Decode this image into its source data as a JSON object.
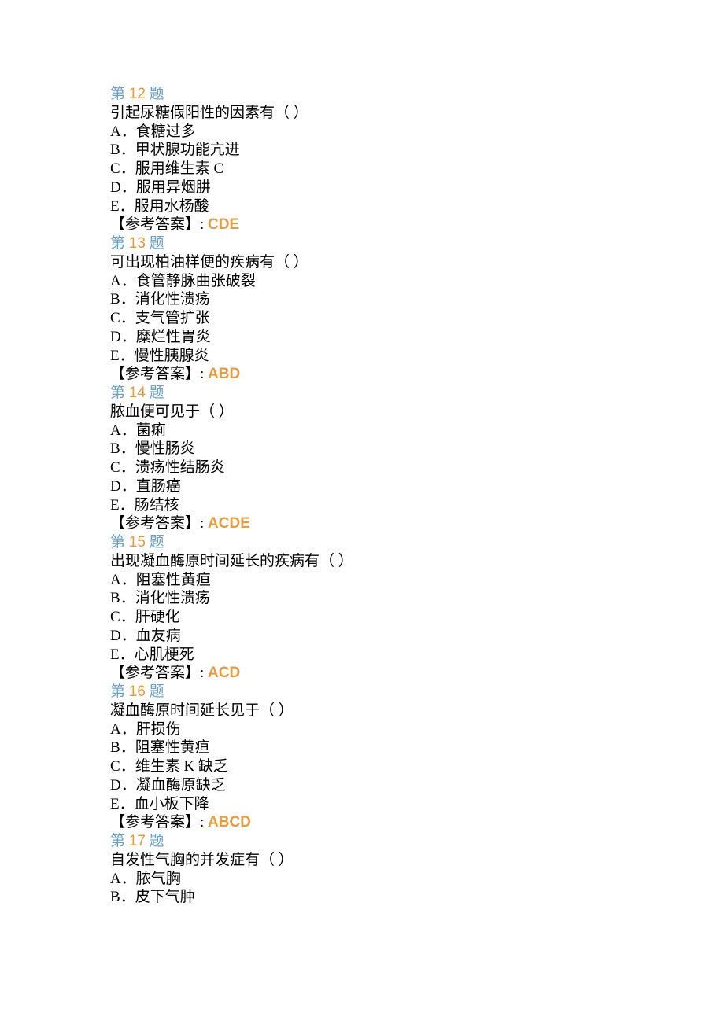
{
  "ui": {
    "question_prefix": "第 ",
    "question_suffix": " 题",
    "answer_label": "【参考答案】: ",
    "option_sep": "．"
  },
  "questions": [
    {
      "number": "12",
      "stem": "引起尿糖假阳性的因素有（ ）",
      "options": [
        {
          "letter": "A",
          "text": "食糖过多"
        },
        {
          "letter": "B",
          "text": "甲状腺功能亢进"
        },
        {
          "letter": "C",
          "text": "服用维生素 C"
        },
        {
          "letter": "D",
          "text": "服用异烟肼"
        },
        {
          "letter": "E",
          "text": "服用水杨酸"
        }
      ],
      "answer": "CDE"
    },
    {
      "number": "13",
      "stem": "可出现柏油样便的疾病有（ ）",
      "options": [
        {
          "letter": "A",
          "text": "食管静脉曲张破裂"
        },
        {
          "letter": "B",
          "text": "消化性溃疡"
        },
        {
          "letter": "C",
          "text": "支气管扩张"
        },
        {
          "letter": "D",
          "text": "糜烂性胃炎"
        },
        {
          "letter": "E",
          "text": "慢性胰腺炎"
        }
      ],
      "answer": "ABD"
    },
    {
      "number": "14",
      "stem": "脓血便可见于（ ）",
      "options": [
        {
          "letter": "A",
          "text": "菌痢"
        },
        {
          "letter": "B",
          "text": "慢性肠炎"
        },
        {
          "letter": "C",
          "text": "溃疡性结肠炎"
        },
        {
          "letter": "D",
          "text": "直肠癌"
        },
        {
          "letter": "E",
          "text": "肠结核"
        }
      ],
      "answer": "ACDE"
    },
    {
      "number": "15",
      "stem": "出现凝血酶原时间延长的疾病有（ ）",
      "options": [
        {
          "letter": "A",
          "text": "阻塞性黄疸"
        },
        {
          "letter": "B",
          "text": "消化性溃疡"
        },
        {
          "letter": "C",
          "text": "肝硬化"
        },
        {
          "letter": "D",
          "text": "血友病"
        },
        {
          "letter": "E",
          "text": "心肌梗死"
        }
      ],
      "answer": "ACD"
    },
    {
      "number": "16",
      "stem": "凝血酶原时间延长见于（ ）",
      "options": [
        {
          "letter": "A",
          "text": "肝损伤"
        },
        {
          "letter": "B",
          "text": "阻塞性黄疸"
        },
        {
          "letter": "C",
          "text": "维生素 K 缺乏"
        },
        {
          "letter": "D",
          "text": "凝血酶原缺乏"
        },
        {
          "letter": "E",
          "text": "血小板下降"
        }
      ],
      "answer": "ABCD"
    },
    {
      "number": "17",
      "stem": "自发性气胸的并发症有（ ）",
      "options": [
        {
          "letter": "A",
          "text": "脓气胸"
        },
        {
          "letter": "B",
          "text": "皮下气肿"
        }
      ],
      "answer": null
    }
  ]
}
